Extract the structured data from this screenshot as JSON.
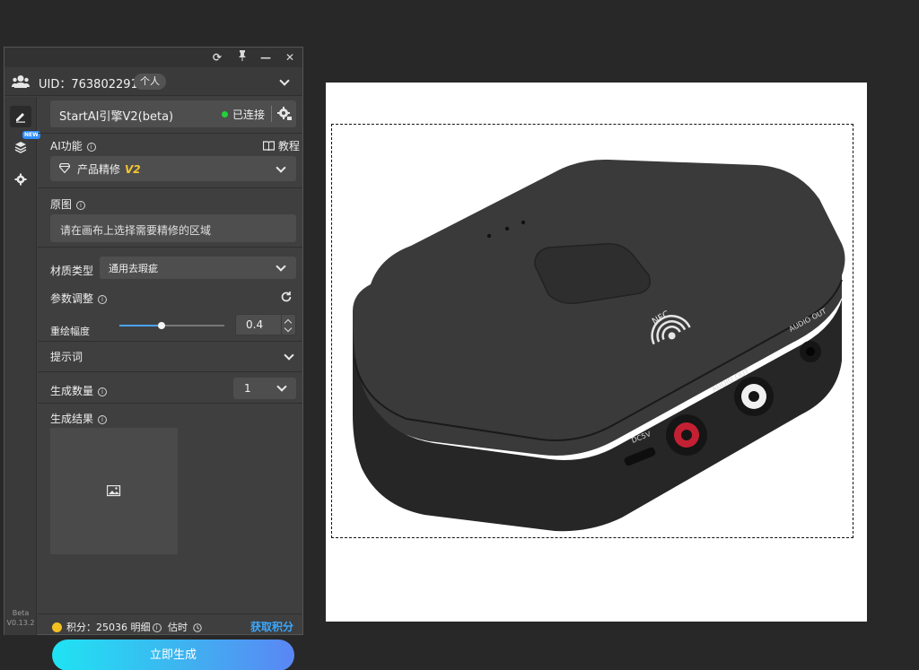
{
  "titlebar": {
    "refresh_icon": "refresh-icon",
    "pin_icon": "pin-icon",
    "minimize_icon": "minimize-icon",
    "close_icon": "close-icon"
  },
  "account": {
    "uid_text": "UID：763802291",
    "tag": "个人"
  },
  "sidebar": {
    "new_badge": "NEW",
    "version_label": "Beta",
    "version_number": "V0.13.2"
  },
  "engine": {
    "name": "StartAI引擎V2(beta)",
    "status": "已连接",
    "status_color": "#22d13a"
  },
  "ai_function": {
    "label": "AI功能",
    "tutorial_label": "教程",
    "selected": "产品精修",
    "selected_version": "V2"
  },
  "original": {
    "label": "原图",
    "placeholder": "请在画布上选择需要精修的区域"
  },
  "material": {
    "label": "材质类型",
    "selected": "通用去瑕疵"
  },
  "params": {
    "label": "参数调整",
    "redraw_label": "重绘幅度",
    "redraw_value": "0.4",
    "redraw_fraction": 0.4
  },
  "prompt": {
    "label": "提示词"
  },
  "count": {
    "label": "生成数量",
    "selected": "1"
  },
  "results": {
    "label": "生成结果"
  },
  "footer": {
    "points_label": "积分：25036",
    "detail_label": "明细",
    "estimate_label": "估时",
    "get_points": "获取积分",
    "generate_button": "立即生成"
  },
  "canvas": {
    "product_labels": {
      "nfc": "NFC",
      "audio_out_left": "AUDIO OUT",
      "audio_out_right": "AUDIO OUT",
      "dc": "DC5V"
    }
  }
}
